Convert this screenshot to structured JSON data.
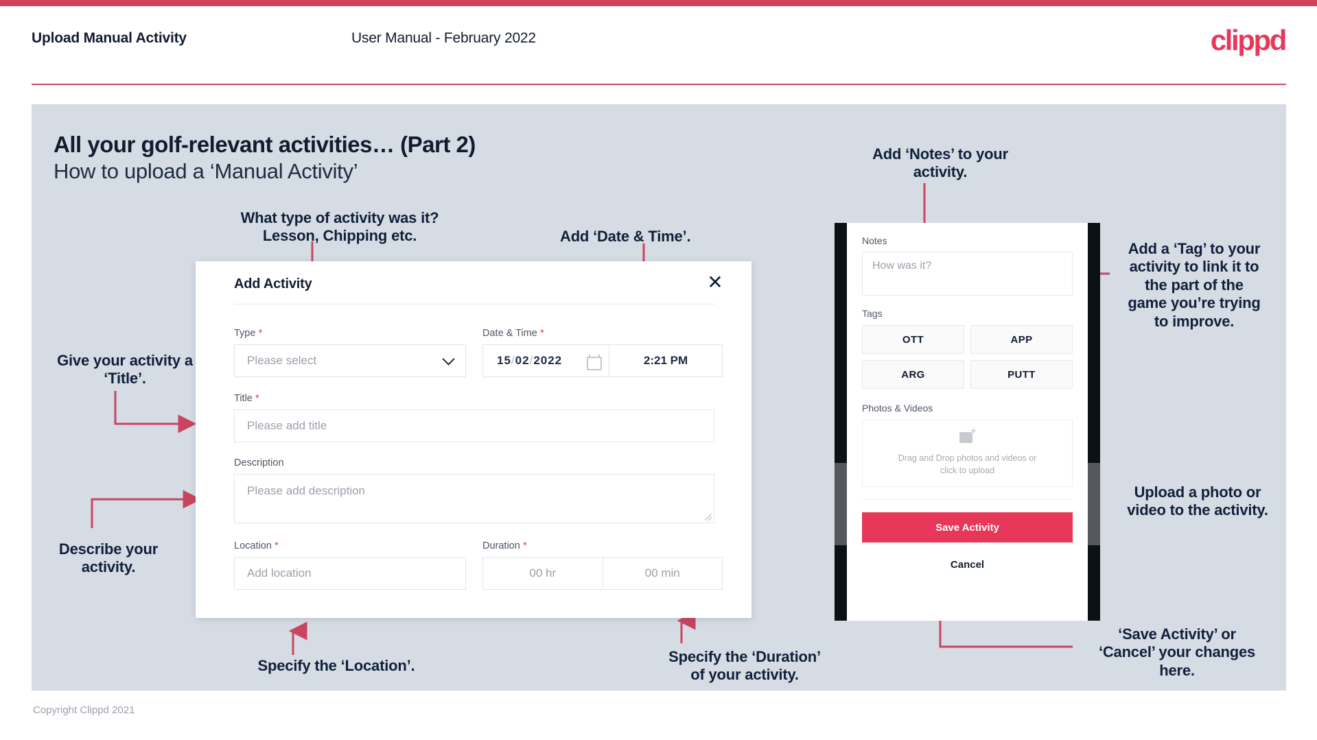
{
  "header": {
    "title": "Upload Manual Activity",
    "subtitle": "User Manual - February 2022",
    "logo": "clippd"
  },
  "slide": {
    "title": "All your golf-relevant activities… (Part 2)",
    "subtitle": "How to upload a ‘Manual Activity’"
  },
  "annotations": {
    "type": "What type of activity was it?\nLesson, Chipping etc.",
    "datetime": "Add ‘Date & Time’.",
    "notes": "Add ‘Notes’ to your\nactivity.",
    "tag": "Add a ‘Tag’ to your\nactivity to link it to\nthe part of the\ngame you’re trying\nto improve.",
    "title": "Give your activity a\n‘Title’.",
    "description": "Describe your\nactivity.",
    "location": "Specify the ‘Location’.",
    "duration": "Specify the ‘Duration’\nof your activity.",
    "upload": "Upload a photo or\nvideo to the activity.",
    "save": "‘Save Activity’ or\n‘Cancel’ your changes\nhere."
  },
  "dialog": {
    "title": "Add Activity",
    "close_icon": "close-icon",
    "fields": {
      "type": {
        "label": "Type",
        "required": true,
        "placeholder": "Please select",
        "value": ""
      },
      "datetime": {
        "label": "Date & Time",
        "required": true,
        "day": "15",
        "month": "02",
        "year": "2022",
        "separator": "/",
        "time": "2:21 PM",
        "calendar_icon": "calendar-icon"
      },
      "title": {
        "label": "Title",
        "required": true,
        "placeholder": "Please add title",
        "value": ""
      },
      "description": {
        "label": "Description",
        "required": false,
        "placeholder": "Please add description",
        "value": ""
      },
      "location": {
        "label": "Location",
        "required": true,
        "placeholder": "Add location",
        "value": ""
      },
      "duration": {
        "label": "Duration",
        "required": true,
        "hours_placeholder": "00 hr",
        "minutes_placeholder": "00 min"
      }
    }
  },
  "phone": {
    "notes": {
      "label": "Notes",
      "placeholder": "How was it?",
      "value": ""
    },
    "tags": {
      "label": "Tags",
      "items": [
        "OTT",
        "APP",
        "ARG",
        "PUTT"
      ]
    },
    "photos": {
      "label": "Photos & Videos",
      "dropzone_line1": "Drag and Drop photos and videos or",
      "dropzone_line2": "click to upload",
      "icon": "add-image-icon"
    },
    "save_label": "Save Activity",
    "cancel_label": "Cancel"
  },
  "footer": {
    "copyright": "Copyright Clippd 2021"
  },
  "colors": {
    "brand_pink": "#e8385a",
    "top_bar": "#cf4459",
    "slide_bg": "#d6dce4",
    "ink": "#111c2e",
    "arrow": "#c9455f"
  }
}
